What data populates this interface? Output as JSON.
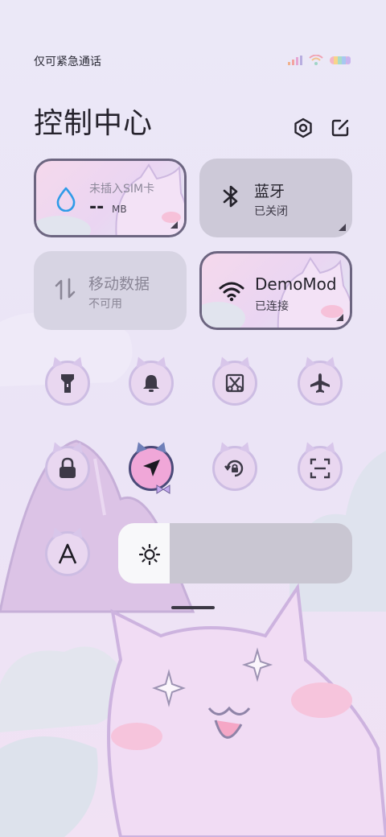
{
  "status_bar": {
    "text": "仅可紧急通话",
    "icons": [
      "signal-icon",
      "wifi-icon",
      "battery-icon"
    ]
  },
  "header": {
    "title": "控制中心",
    "settings_icon": "settings-icon",
    "edit_icon": "edit-icon"
  },
  "tiles": [
    {
      "key": "data_usage",
      "icon": "droplet-icon",
      "name": "未插入SIM卡",
      "value": "--",
      "unit": "MB"
    },
    {
      "key": "bluetooth",
      "icon": "bluetooth-icon",
      "name": "蓝牙",
      "status": "已关闭"
    },
    {
      "key": "mobile_data",
      "icon": "mobile-data-icon",
      "name": "移动数据",
      "status": "不可用"
    },
    {
      "key": "wifi",
      "icon": "wifi-icon",
      "name": "DemoMod",
      "status": "已连接"
    }
  ],
  "toggles": [
    {
      "icon": "flashlight-icon"
    },
    {
      "icon": "bell-icon"
    },
    {
      "icon": "screenshot-icon"
    },
    {
      "icon": "airplane-icon"
    },
    {
      "icon": "lock-icon"
    },
    {
      "icon": "location-icon",
      "active": true
    },
    {
      "icon": "rotation-lock-icon"
    },
    {
      "icon": "scan-icon"
    },
    {
      "icon": "font-icon"
    }
  ],
  "brightness": {
    "icon": "sun-icon",
    "level": 0.22
  },
  "colors": {
    "background": "#ebe8f7",
    "tile_gray": "#cdc9d8",
    "accent_pink": "#f0a7d8",
    "dark": "#26232d"
  }
}
